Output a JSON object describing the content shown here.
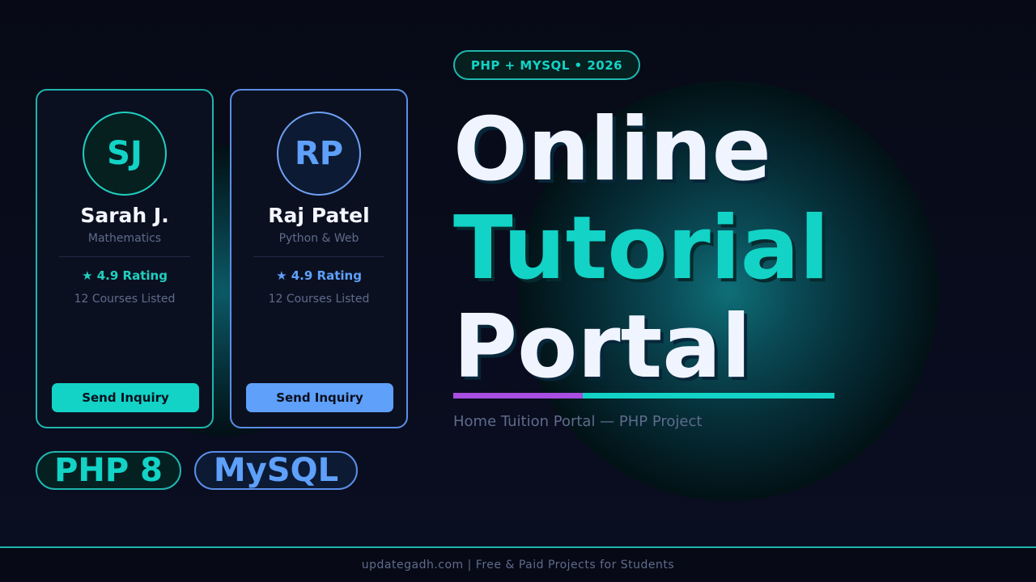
{
  "top_badge": "PHP + MYSQL  •  2026",
  "headline": {
    "line1": "Online",
    "line2": "Tutorial",
    "line3": "Portal"
  },
  "subtitle": "Home Tuition Portal — PHP Project",
  "cards": [
    {
      "initials": "SJ",
      "name": "Sarah J.",
      "subject": "Mathematics",
      "rating": "★  4.9 Rating",
      "courses": "12 Courses Listed",
      "button": "Send Inquiry",
      "accent": "#12d3c6"
    },
    {
      "initials": "RP",
      "name": "Raj Patel",
      "subject": "Python & Web",
      "rating": "★  4.9 Rating",
      "courses": "12 Courses Listed",
      "button": "Send Inquiry",
      "accent": "#5ea0fa"
    }
  ],
  "tech_badges": [
    "PHP 8",
    "MySQL"
  ],
  "footer": "updategadh.com  |  Free & Paid Projects for Students",
  "colors": {
    "teal": "#12d3c6",
    "blue": "#5ea0fa",
    "purple": "#a84ee0",
    "background": "#070a16"
  }
}
